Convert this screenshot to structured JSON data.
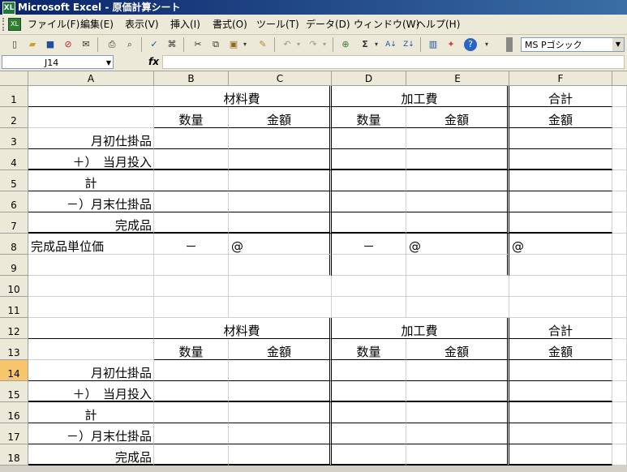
{
  "window": {
    "title": "Microsoft Excel - 原価計算シート",
    "app_icon": "XL"
  },
  "menus": [
    "ファイル(F)",
    "編集(E)",
    "表示(V)",
    "挿入(I)",
    "書式(O)",
    "ツール(T)",
    "データ(D)",
    "ウィンドウ(W)",
    "ヘルプ(H)"
  ],
  "toolbar": {
    "font_name": "MS Pゴシック"
  },
  "formula_bar": {
    "name_box": "J14",
    "fx": "fx",
    "formula": ""
  },
  "columns": [
    "A",
    "B",
    "C",
    "D",
    "E",
    "F"
  ],
  "rows": [
    "1",
    "2",
    "3",
    "4",
    "5",
    "6",
    "7",
    "8",
    "9",
    "10",
    "11",
    "12",
    "13",
    "14",
    "15",
    "16",
    "17",
    "18"
  ],
  "table": {
    "headers": {
      "material": "材料費",
      "processing": "加工費",
      "total": "合計",
      "qty": "数量",
      "amount": "金額"
    },
    "labels": {
      "wip_begin": "月初仕掛品",
      "input": "＋）　当月投入",
      "subtotal": "計",
      "wip_end": "－）月末仕掛品",
      "finished": "完成品",
      "unit_cost": "完成品単位価"
    },
    "marks": {
      "dash": "－",
      "at": "@"
    }
  }
}
